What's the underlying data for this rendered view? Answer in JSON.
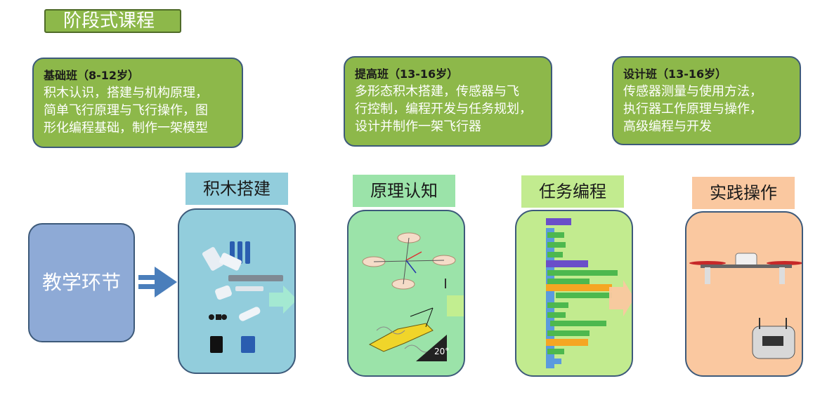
{
  "header": {
    "title": "阶段式课程"
  },
  "classes": [
    {
      "name": "基础班（8-12岁）",
      "lines": [
        "积木认识，搭建与机构原理，",
        "简单飞行原理与飞行操作，图",
        "形化编程基础，制作一架模型"
      ]
    },
    {
      "name": "提高班（13-16岁）",
      "lines": [
        "多形态积木搭建，传感器与飞",
        "行控制，编程开发与任务规划，",
        "设计并制作一架飞行器"
      ]
    },
    {
      "name": "设计班（13-16岁）",
      "lines": [
        "传感器测量与使用方法，",
        "执行器工作原理与操作，",
        "高级编程与开发"
      ]
    }
  ],
  "teaching": {
    "label": "教学环节"
  },
  "steps": [
    {
      "label": "积木搭建",
      "label_color": "#92cddc",
      "panel_color": "#92cddc"
    },
    {
      "label": "原理认知",
      "label_color": "#9be3a9",
      "panel_color": "#9be3a9"
    },
    {
      "label": "任务编程",
      "label_color": "#c2eb8f",
      "panel_color": "#c2eb8f"
    },
    {
      "label": "实践操作",
      "label_color": "#fac8a0",
      "panel_color": "#fac8a0"
    }
  ],
  "figure_texts": {
    "angle": "20°"
  },
  "colors": {
    "class_card_bg": "#8db84a",
    "border": "#3d5a7a",
    "teaching_bg": "#8eaad6",
    "arrow_blue": "#4a7ebb"
  }
}
